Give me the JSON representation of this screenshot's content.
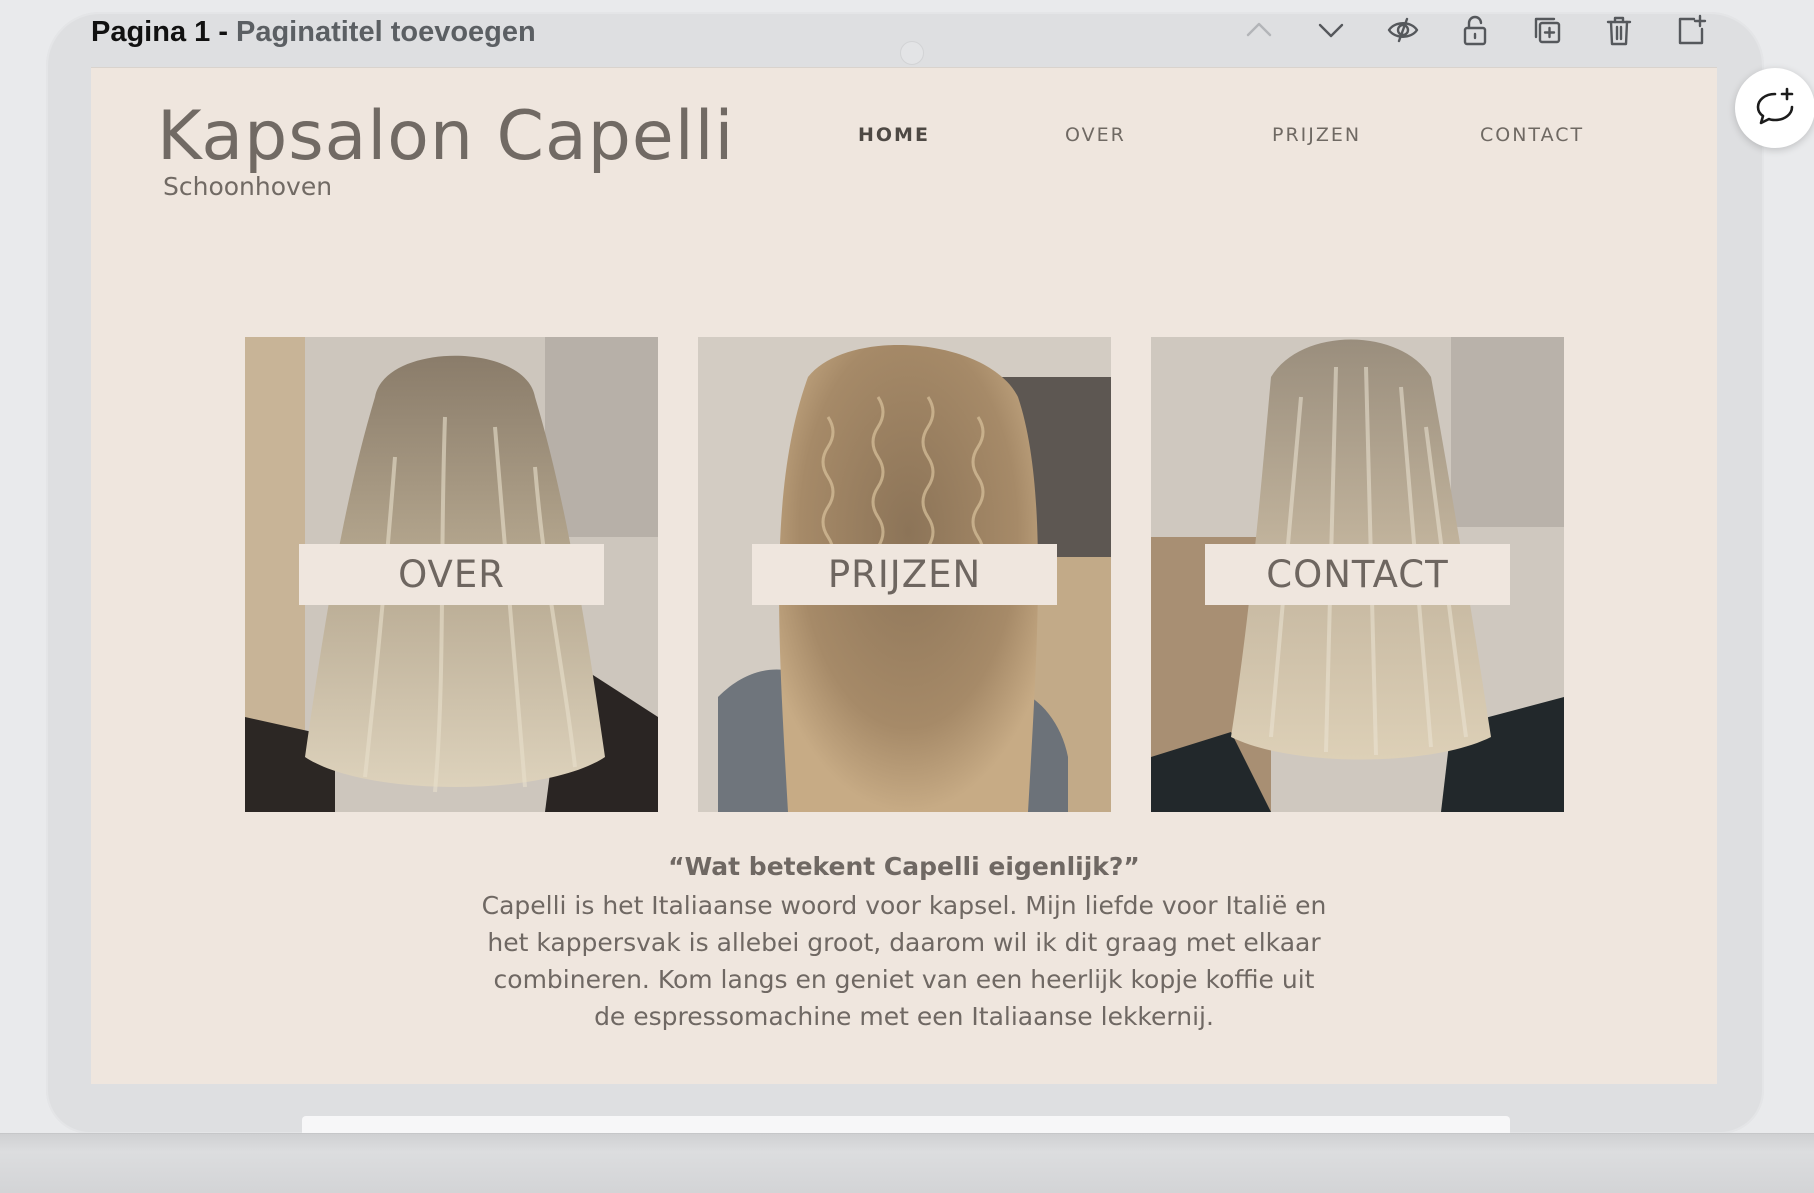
{
  "editor": {
    "page_number": "Pagina 1 -",
    "page_title_placeholder": "Paginatitel toevoegen",
    "toolbar": [
      "chevron-up-icon",
      "chevron-down-icon",
      "eye-icon",
      "lock-icon",
      "duplicate-icon",
      "trash-icon",
      "add-page-icon"
    ],
    "comment_icon": "add-comment-icon"
  },
  "site": {
    "brand": {
      "name": "Kapsalon Capelli",
      "subtitle": "Schoonhoven"
    },
    "nav": [
      {
        "label": "HOME",
        "active": true
      },
      {
        "label": "OVER",
        "active": false
      },
      {
        "label": "PRIJZEN",
        "active": false
      },
      {
        "label": "CONTACT",
        "active": false
      }
    ],
    "tiles": [
      {
        "label": "OVER",
        "photo": "blonde wavy hair from behind"
      },
      {
        "label": "PRIJZEN",
        "photo": "curly highlighted hair from behind"
      },
      {
        "label": "CONTACT",
        "photo": "straight blonde bob from behind"
      }
    ],
    "quote_title": "“Wat betekent Capelli eigenlijk?”",
    "quote_body": "Capelli is het Italiaanse woord voor kapsel. Mijn liefde voor Italië en het kappersvak is allebei groot, daarom wil ik dit graag met elkaar combineren. Kom langs en geniet van een heerlijk kopje koffie uit de espressomachine met een Italiaanse lekkernij."
  },
  "colors": {
    "canvas": "#efe6de",
    "text": "#6f6963",
    "frame": "#dedfe1"
  }
}
